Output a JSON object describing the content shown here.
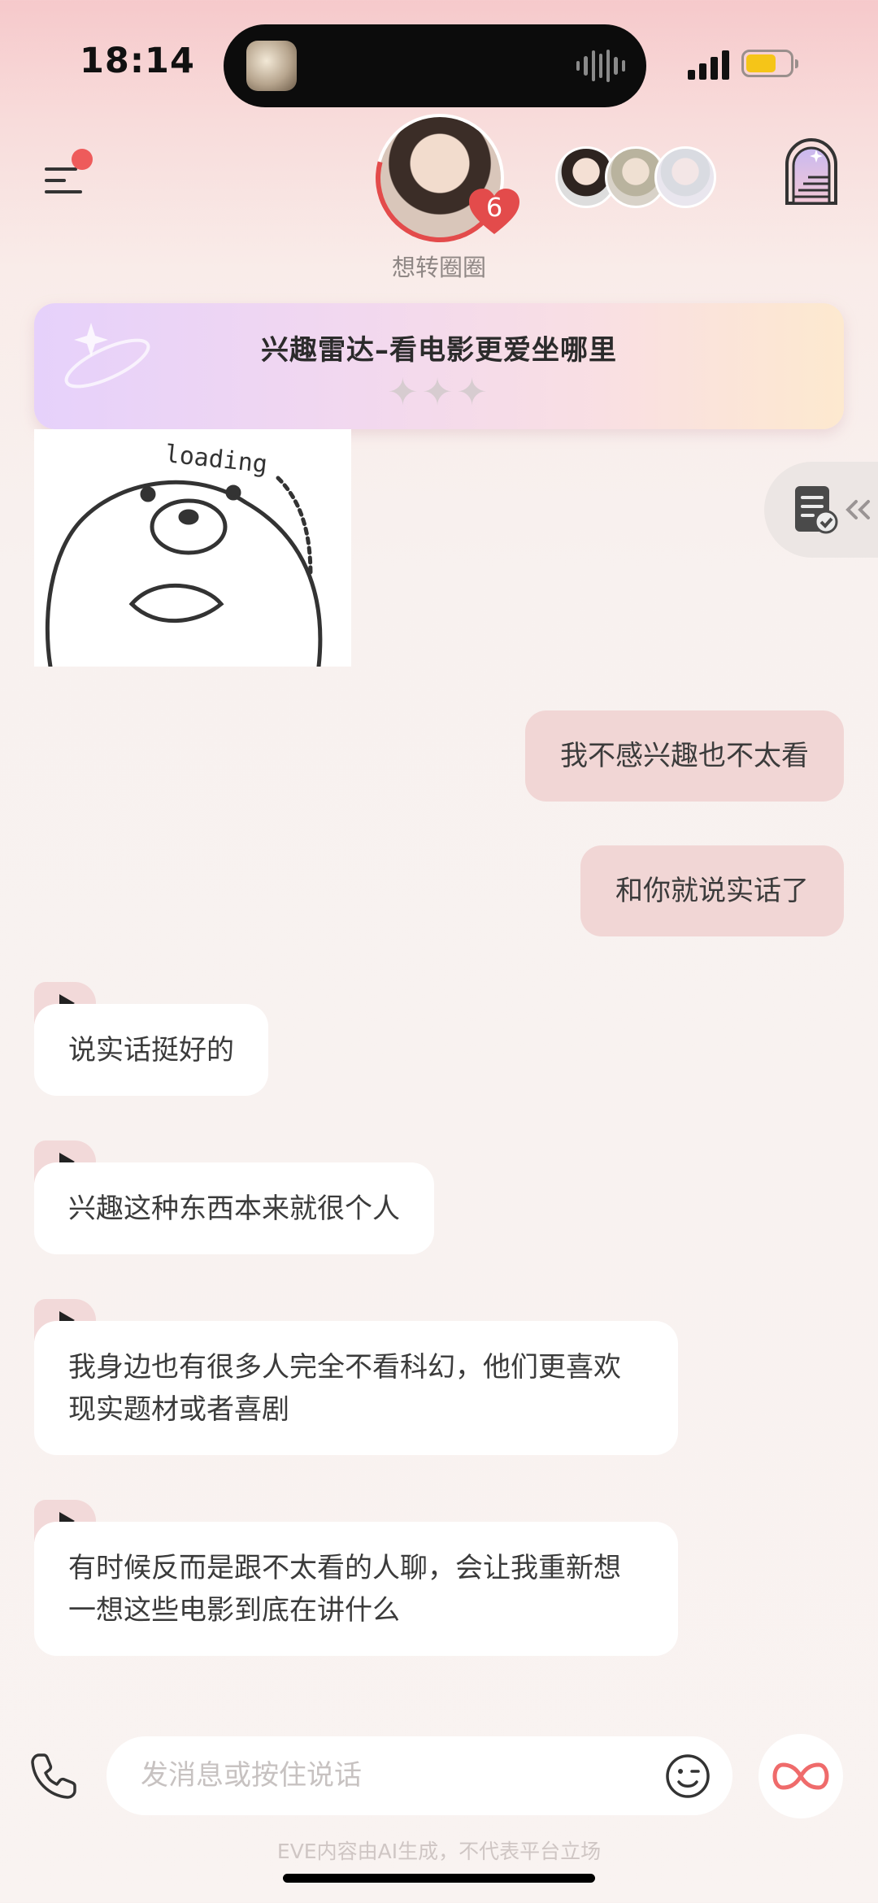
{
  "status_bar": {
    "time": "18:14"
  },
  "header": {
    "character_name": "想转圈圈",
    "badge_count": "6",
    "menu_icon": "menu-icon",
    "castle_icon": "castle-door-icon"
  },
  "topic": {
    "title": "兴趣雷达–看电影更爱坐哪里"
  },
  "sticker": {
    "caption": "loading"
  },
  "messages": [
    {
      "side": "right",
      "text": "我不感兴趣也不太看"
    },
    {
      "side": "right",
      "text": "和你就说实话了"
    },
    {
      "side": "left",
      "text": "说实话挺好的"
    },
    {
      "side": "left",
      "text": "兴趣这种东西本来就很个人"
    },
    {
      "side": "left",
      "text": "我身边也有很多人完全不看科幻，他们更喜欢现实题材或者喜剧"
    },
    {
      "side": "left",
      "text": "有时候反而是跟不太看的人聊，会让我重新想一想这些电影到底在讲什么"
    }
  ],
  "input": {
    "placeholder": "发消息或按住说话"
  },
  "footer": {
    "disclaimer": "EVE内容由AI生成，不代表平台立场"
  },
  "colors": {
    "accent": "#e34b4b",
    "bubble_right": "#f1d6d5",
    "bubble_left": "#ffffff",
    "battery": "#f5c518"
  }
}
